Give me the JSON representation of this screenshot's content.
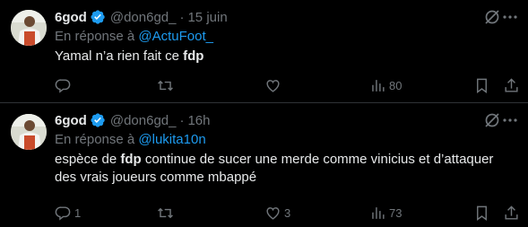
{
  "tweets": [
    {
      "author_name": "6god",
      "handle": "@don6gd_",
      "separator": "·",
      "time": "15 juin",
      "reply_prefix": "En réponse à ",
      "reply_to": "@ActuFoot_",
      "text_before": "Yamal n’a rien fait ce ",
      "text_bold": "fdp",
      "text_after": "",
      "replies": "",
      "retweets": "",
      "likes": "",
      "views": "80"
    },
    {
      "author_name": "6god",
      "handle": "@don6gd_",
      "separator": "·",
      "time": "16h",
      "reply_prefix": "En réponse à ",
      "reply_to": "@lukita10n",
      "text_before": "espèce de ",
      "text_bold": "fdp",
      "text_after": " continue de sucer une merde comme vinicius et d’attaquer des vrais joueurs comme mbappé",
      "replies": "1",
      "retweets": "",
      "likes": "3",
      "views": "73"
    }
  ],
  "colors": {
    "background": "#000000",
    "text": "#e7e9ea",
    "muted": "#71767b",
    "accent": "#1d9bf0",
    "divider": "#2f3336"
  },
  "icons": [
    "verified-badge-icon",
    "grok-icon",
    "more-icon",
    "reply-icon",
    "retweet-icon",
    "like-icon",
    "views-icon",
    "bookmark-icon",
    "share-icon"
  ]
}
